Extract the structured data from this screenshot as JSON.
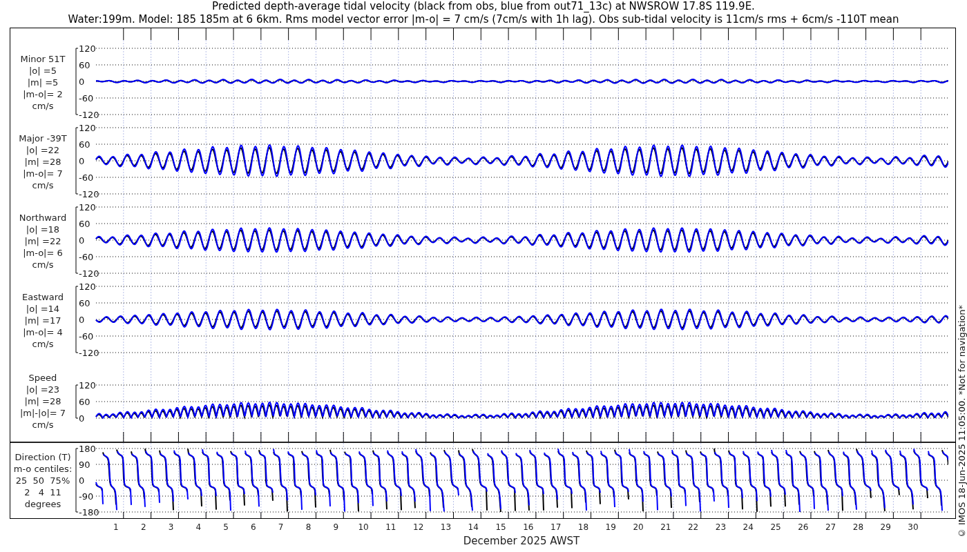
{
  "title_lines": [
    "Predicted depth-average tidal velocity (black from obs, blue from out71_13c) at NWSROW 17.8S 119.9E.",
    "Water:199m. Model: 185 185m at 6 6km. Rms model vector error |m-o| = 7 cm/s (7cm/s with 1h lag). Obs sub-tidal velocity is 11cm/s rms + 6cm/s -110T mean"
  ],
  "panels": [
    {
      "kind": "velocity",
      "label_lines": [
        "Minor 51T",
        "|o| =5",
        "|m| =5",
        "|m-o|= 2",
        "cm/s"
      ],
      "yticks": [
        "120",
        "60",
        "0",
        "-60",
        "-120"
      ]
    },
    {
      "kind": "velocity",
      "label_lines": [
        "Major -39T",
        "|o| =22",
        "|m| =28",
        "|m-o|= 7",
        "cm/s"
      ],
      "yticks": [
        "120",
        "60",
        "0",
        "-60",
        "-120"
      ]
    },
    {
      "kind": "velocity",
      "label_lines": [
        "Northward",
        "|o| =18",
        "|m| =22",
        "|m-o|= 6",
        "cm/s"
      ],
      "yticks": [
        "120",
        "60",
        "0",
        "-60",
        "-120"
      ]
    },
    {
      "kind": "velocity",
      "label_lines": [
        "Eastward",
        "|o| =14",
        "|m| =17",
        "|m-o|= 4",
        "cm/s"
      ],
      "yticks": [
        "120",
        "60",
        "0",
        "-60",
        "-120"
      ]
    },
    {
      "kind": "speed",
      "label_lines": [
        "Speed",
        "|o| =23",
        "|m| =28",
        "|m|-|o|= 7",
        "cm/s"
      ],
      "yticks": [
        "120",
        "60",
        "0"
      ]
    },
    {
      "kind": "direction",
      "label_lines": [
        "Direction (T)",
        "m-o centiles:",
        "25  50  75%",
        "2   4  11",
        "degrees"
      ],
      "yticks": [
        "180",
        "90",
        "0",
        "-90",
        "-180"
      ]
    }
  ],
  "x_tick_labels": [
    "1",
    "2",
    "3",
    "4",
    "5",
    "6",
    "7",
    "8",
    "9",
    "10",
    "11",
    "12",
    "13",
    "14",
    "15",
    "16",
    "17",
    "18",
    "19",
    "20",
    "21",
    "22",
    "23",
    "24",
    "25",
    "26",
    "27",
    "28",
    "29",
    "30"
  ],
  "xlabel": "December 2025 AWST",
  "credit": "© IMOS 18-Jun-2025 11:05:00. *Not for navigation*"
}
